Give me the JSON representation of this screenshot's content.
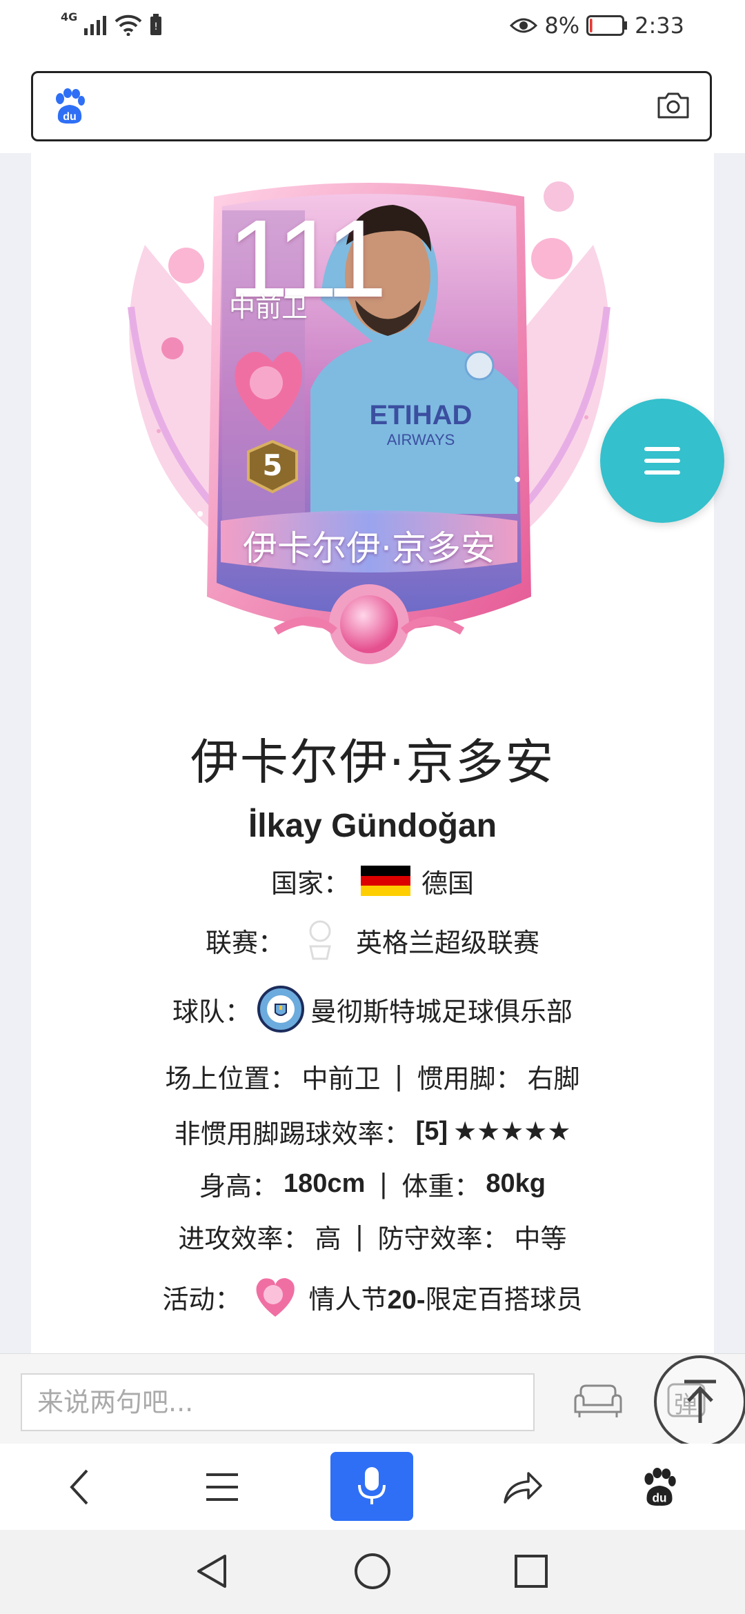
{
  "status_bar": {
    "network": "4G",
    "battery_percent": "8%",
    "time": "2:33",
    "battery_level": 0.08,
    "battery_color": "#e53935"
  },
  "search": {
    "placeholder": "",
    "logo_icon": "baidu-paw-icon",
    "camera_icon": "camera-icon"
  },
  "player_card": {
    "rating": "111",
    "position": "中前卫",
    "level": "5",
    "name": "伊卡尔伊·京多安"
  },
  "player": {
    "name_cn": "伊卡尔伊·京多安",
    "name_en": "İlkay Gündoğan",
    "country_label": "国家：",
    "country": "德国",
    "league_label": "联赛：",
    "league": "英格兰超级联赛",
    "team_label": "球队：",
    "team": "曼彻斯特城足球俱乐部",
    "position_label": "场上位置：",
    "position": "中前卫",
    "sep1": " | ",
    "foot_label": "惯用脚：",
    "foot": "右脚",
    "weak_foot_label": "非惯用脚踢球效率：",
    "weak_foot_value": "[5]",
    "weak_foot_stars": "★★★★★",
    "height_label": "身高：",
    "height": "180cm",
    "sep2": " | ",
    "weight_label": "体重：",
    "weight": "80kg",
    "attack_label": "进攻效率：",
    "attack": "高",
    "sep3": " | ",
    "defense_label": "防守效率：",
    "defense": "中等",
    "event_label": "活动：",
    "event_a": "情人节",
    "event_b": "20-",
    "event_c": "限定百搭球员"
  },
  "comment": {
    "placeholder": "来说两句吧...",
    "danmu_label": "弹"
  },
  "colors": {
    "fab": "#34c0cc",
    "mic_button": "#2e6ff5",
    "baidu_blue": "#2e6ff5"
  }
}
